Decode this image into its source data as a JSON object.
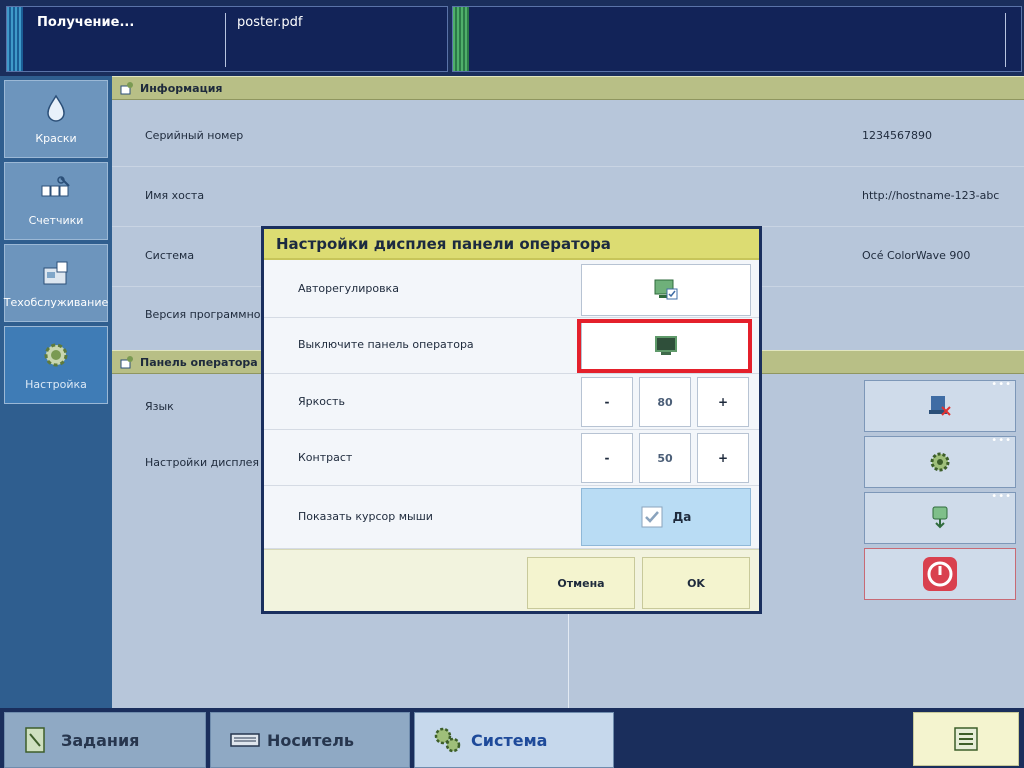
{
  "top_bar": {
    "job_status": "Получение...",
    "job_file": "poster.pdf"
  },
  "left_nav": [
    {
      "label": "Краски",
      "icon": "ink-drop-icon"
    },
    {
      "label": "Счетчики",
      "icon": "counters-icon"
    },
    {
      "label": "Техобслуживание",
      "icon": "maintenance-icon"
    },
    {
      "label": "Настройка",
      "icon": "settings-gear-icon",
      "active": true
    }
  ],
  "info_section": {
    "title": "Информация",
    "rows": [
      {
        "label": "Серийный номер",
        "value": "1234567890"
      },
      {
        "label": "Имя хоста",
        "value": "http://hostname-123-abc"
      },
      {
        "label": "Система",
        "value": "Océ ColorWave 900"
      },
      {
        "label": "Версия программного о",
        "value": ""
      }
    ]
  },
  "panel_section": {
    "title": "Панель оператора",
    "rows": [
      {
        "label": "Язык"
      },
      {
        "label": "Настройки дисплея пан"
      }
    ],
    "side_buttons": [
      {
        "icon": "panel-cancel-icon"
      },
      {
        "icon": "gear-settings-icon"
      },
      {
        "icon": "calibration-icon"
      },
      {
        "icon": "power-off-icon"
      }
    ]
  },
  "dialog": {
    "title": "Настройки дисплея панели оператора",
    "auto_adjust_label": "Авторегулировка",
    "turn_off_label": "Выключите панель оператора",
    "brightness_label": "Яркость",
    "brightness_value": "80",
    "contrast_label": "Контраст",
    "contrast_value": "50",
    "minus": "-",
    "plus": "+",
    "mouse_cursor_label": "Показать курсор мыши",
    "mouse_cursor_value": "Да",
    "cancel": "Отмена",
    "ok": "OK"
  },
  "bottom_tabs": [
    {
      "label": "Задания",
      "icon": "jobs-icon"
    },
    {
      "label": "Носитель",
      "icon": "media-icon"
    },
    {
      "label": "Система",
      "icon": "system-icon",
      "active": true
    }
  ],
  "colors": {
    "accent_yellow": "#dcdc72",
    "highlight_red": "#e4202b",
    "nav_blue": "#2f5e8f"
  }
}
